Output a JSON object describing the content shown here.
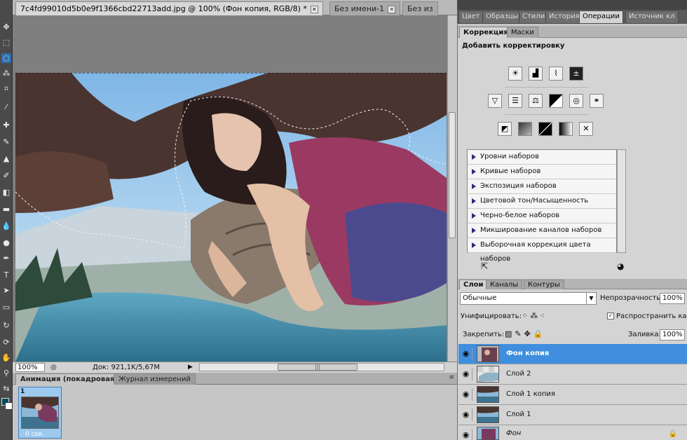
{
  "tabs": {
    "doc": "7c4fd99010d5b0e9f1366cbd22713add.jpg @ 100% (Фон копия, RGB/8) *",
    "untitled": "Без имени-1",
    "third": "Без из"
  },
  "status": {
    "zoom": "100%",
    "doc": "Док: 921,1K/5,67M"
  },
  "bottom_tabs": {
    "animation": "Анимация (покадровая)",
    "measure": "Журнал измерений"
  },
  "frame": {
    "number": "1",
    "delay": "0 сек."
  },
  "top_tabs": [
    "Цвет",
    "Образцы",
    "Стили",
    "История",
    "Операции",
    "Источник кл"
  ],
  "corr_tabs": {
    "correction": "Коррекция",
    "masks": "Маски"
  },
  "corr_title": "Добавить корректировку",
  "adj_icons": [
    "brightness-icon",
    "levels-icon",
    "curves-icon",
    "exposure-icon",
    "vibrance-icon",
    "hue-saturation-icon",
    "color-balance-icon",
    "black-white-icon",
    "photo-filter-icon",
    "channel-mixer-icon",
    "invert-icon",
    "posterize-icon",
    "threshold-icon",
    "gradient-map-icon",
    "selective-color-icon"
  ],
  "presets": [
    "Уровни наборов",
    "Кривые наборов",
    "Экспозиция наборов",
    "Цветовой тон/Насыщенность наборов",
    "Черно-белое наборов",
    "Микширование каналов наборов",
    "Выборочная коррекция цвета наборов"
  ],
  "layer_tabs": {
    "layers": "Слои",
    "channels": "Каналы",
    "paths": "Контуры"
  },
  "layers_panel": {
    "blend_mode": "Обычные",
    "opacity_label": "Непрозрачность:",
    "opacity": "100%",
    "unify_label": "Унифицировать:",
    "propagate_label": "Распространить кад",
    "lock_label": "Закрепить:",
    "fill_label": "Заливка:",
    "fill": "100%"
  },
  "layers": [
    {
      "name": "Фон копия",
      "selected": true
    },
    {
      "name": "Слой 2",
      "selected": false
    },
    {
      "name": "Слой 1 копия",
      "selected": false
    },
    {
      "name": "Слой 1",
      "selected": false
    },
    {
      "name": "Фон",
      "selected": false,
      "italic": true
    }
  ],
  "colors": {
    "accent": "#3f8fde",
    "foreground": "#0b4a5a",
    "background": "#ffffff"
  }
}
